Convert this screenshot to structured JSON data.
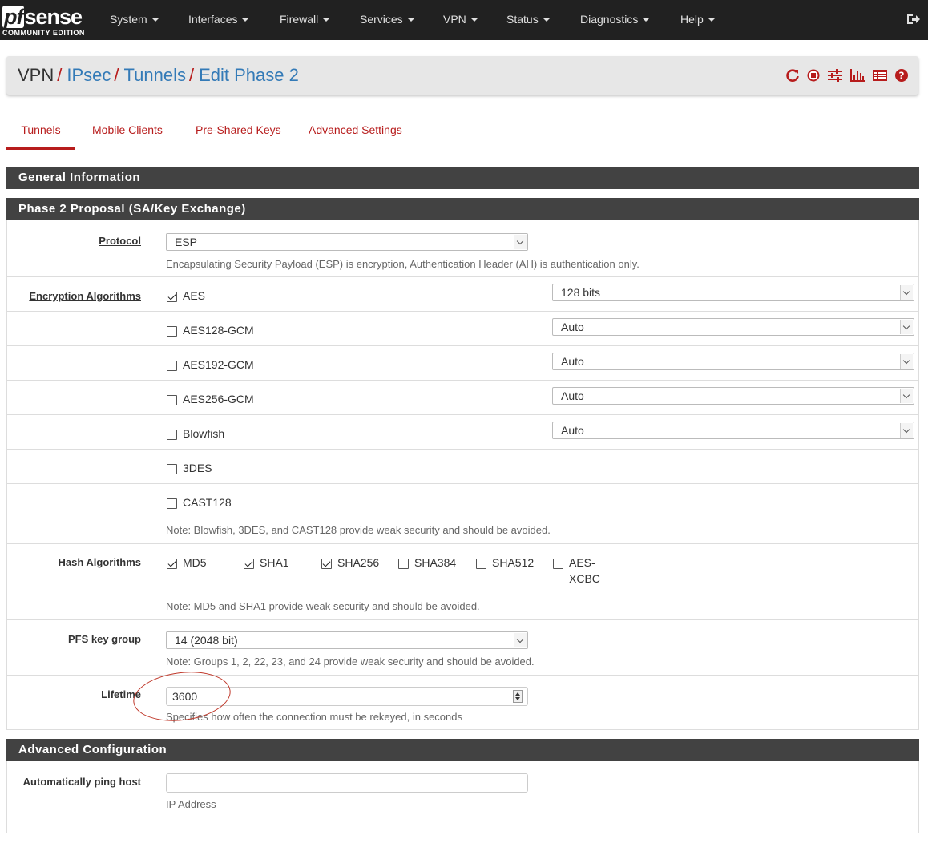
{
  "brand": {
    "name": "sense",
    "prefix": "pf",
    "edition": "COMMUNITY EDITION"
  },
  "nav": {
    "items": [
      "System",
      "Interfaces",
      "Firewall",
      "Services",
      "VPN",
      "Status",
      "Diagnostics",
      "Help"
    ]
  },
  "breadcrumb": {
    "root": "VPN",
    "links": [
      "IPsec",
      "Tunnels",
      "Edit Phase 2"
    ],
    "separator": "/"
  },
  "toolbar": {
    "icons": [
      "restart-service-icon",
      "stop-service-icon",
      "sliders-icon",
      "bar-chart-icon",
      "list-log-icon",
      "help-icon"
    ],
    "icon_color": "#b71c1c"
  },
  "tabs": [
    "Tunnels",
    "Mobile Clients",
    "Pre-Shared Keys",
    "Advanced Settings"
  ],
  "sections": {
    "general": "General Information",
    "phase2": "Phase 2 Proposal (SA/Key Exchange)",
    "advanced": "Advanced Configuration"
  },
  "protocol": {
    "label": "Protocol",
    "value": "ESP",
    "help": "Encapsulating Security Payload (ESP) is encryption, Authentication Header (AH) is authentication only."
  },
  "encryption": {
    "label": "Encryption Algorithms",
    "algorithms": [
      {
        "name": "AES",
        "checked": true,
        "keylen": "128 bits"
      },
      {
        "name": "AES128-GCM",
        "checked": false,
        "keylen": "Auto"
      },
      {
        "name": "AES192-GCM",
        "checked": false,
        "keylen": "Auto"
      },
      {
        "name": "AES256-GCM",
        "checked": false,
        "keylen": "Auto"
      },
      {
        "name": "Blowfish",
        "checked": false,
        "keylen": "Auto"
      },
      {
        "name": "3DES",
        "checked": false
      },
      {
        "name": "CAST128",
        "checked": false
      }
    ],
    "note": "Note: Blowfish, 3DES, and CAST128 provide weak security and should be avoided."
  },
  "hash": {
    "label": "Hash Algorithms",
    "algorithms": [
      {
        "name": "MD5",
        "checked": true
      },
      {
        "name": "SHA1",
        "checked": true
      },
      {
        "name": "SHA256",
        "checked": true
      },
      {
        "name": "SHA384",
        "checked": false
      },
      {
        "name": "SHA512",
        "checked": false
      },
      {
        "name": "AES-",
        "name2": "XCBC",
        "checked": false
      }
    ],
    "note": "Note: MD5 and SHA1 provide weak security and should be avoided."
  },
  "pfs": {
    "label": "PFS key group",
    "value": "14 (2048 bit)",
    "note": "Note: Groups 1, 2, 22, 23, and 24 provide weak security and should be avoided."
  },
  "lifetime": {
    "label": "Lifetime",
    "value": "3600",
    "help": "Specifies how often the connection must be rekeyed, in seconds"
  },
  "ping_host": {
    "label": "Automatically ping host",
    "value": "",
    "help": "IP Address"
  }
}
